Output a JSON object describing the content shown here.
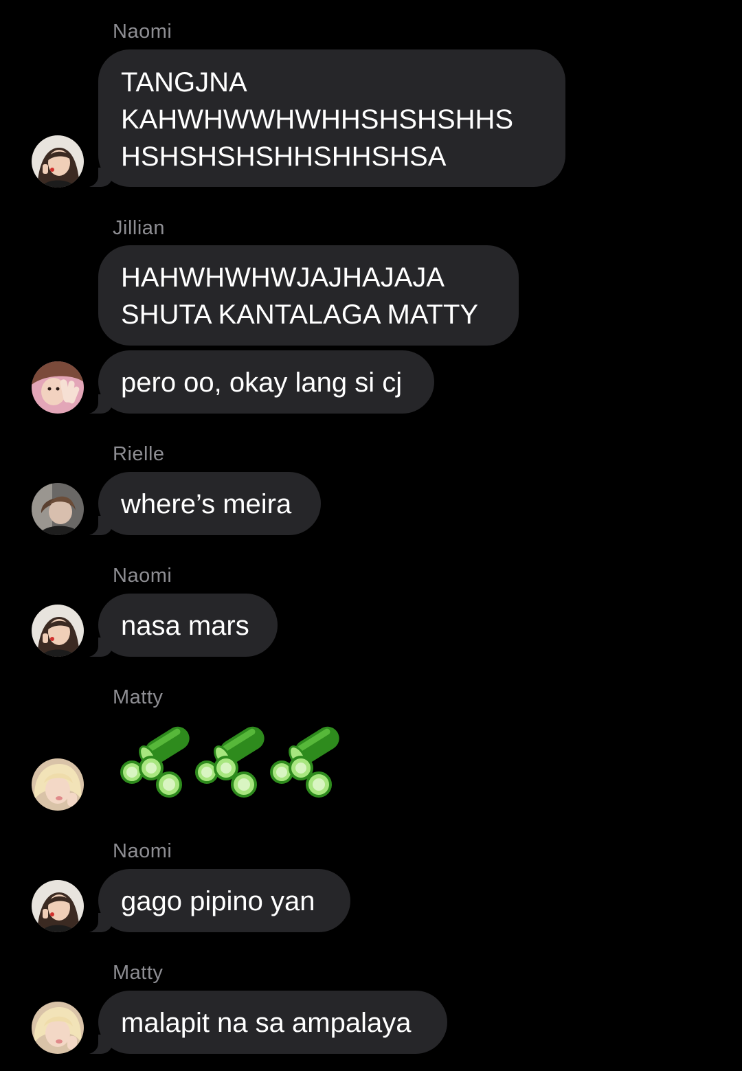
{
  "messages": [
    {
      "sender": "Naomi",
      "lines": [
        "TANGJNA",
        "KAHWHWWHWHHSHSHSHHS",
        "HSHSHSHSHHSHHSHSA"
      ]
    },
    {
      "sender": "Jillian",
      "lines": [
        "HAHWHWHWJAJHAJAJA",
        "SHUTA KANTALAGA MATTY"
      ]
    },
    {
      "text": "pero oo, okay lang si cj"
    },
    {
      "sender": "Rielle",
      "text": "where’s meira"
    },
    {
      "sender": "Naomi",
      "text": "nasa mars"
    },
    {
      "sender": "Matty",
      "sticker": "cucumber-slices-sticker",
      "count": 3
    },
    {
      "sender": "Naomi",
      "text": "gago pipino yan"
    },
    {
      "sender": "Matty",
      "text": "malapit na sa ampalaya"
    }
  ],
  "theme": {
    "background": "#000000",
    "bubble": "#262629",
    "sender_name": "#8e8e93",
    "cucumber_dark": "#2e8b1d",
    "cucumber_light": "#7fd85a"
  }
}
